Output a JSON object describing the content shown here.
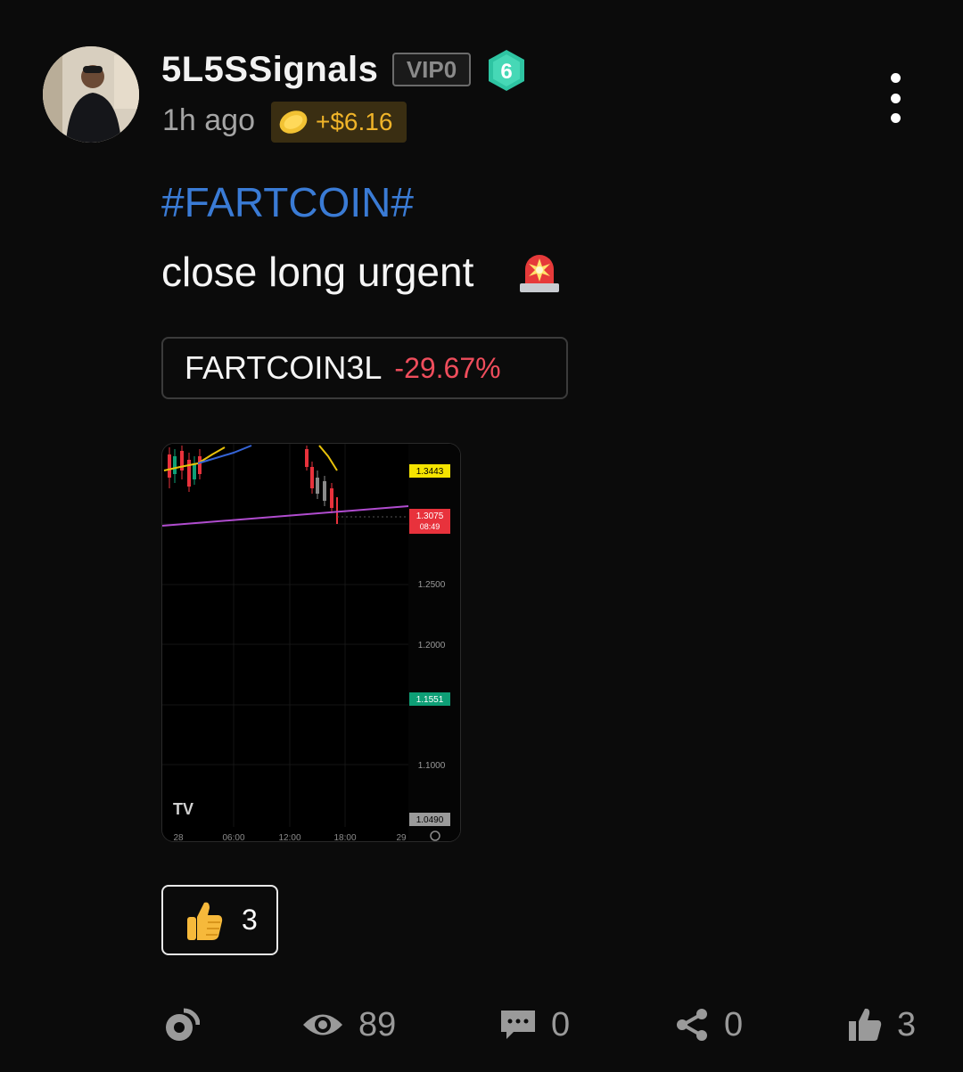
{
  "post": {
    "username": "5L5SSignals",
    "vip_label": "VIP0",
    "level": "6",
    "time_ago": "1h ago",
    "earnings": "+$6.16",
    "hashtag": "#FARTCOIN#",
    "text": "close long urgent",
    "ticker": {
      "symbol": "FARTCOIN3L",
      "change": "-29.67%"
    },
    "reaction": {
      "emoji": "thumbs-up",
      "count": "3"
    }
  },
  "stats": {
    "views": "89",
    "comments": "0",
    "shares": "0",
    "likes": "3"
  },
  "chart_image": {
    "price_tags": [
      {
        "label": "1.3443",
        "color": "#f5e400"
      },
      {
        "label": "1.3075",
        "sub": "08:49",
        "color": "#e8323c"
      },
      {
        "label": "1.1551",
        "color": "#0e9f76"
      },
      {
        "label": "1.0490",
        "color": "#9a9a9a"
      }
    ],
    "y_ticks": [
      "1.2500",
      "1.2000",
      "1.1000"
    ],
    "x_ticks": [
      "28",
      "06:00",
      "12:00",
      "18:00",
      "29"
    ],
    "logo": "TV"
  },
  "colors": {
    "hashtag": "#3a7bd5",
    "negative": "#ef4d5c",
    "gold": "#f0b429",
    "level_badge": "#2ec4a2"
  },
  "icons": [
    "avatar",
    "level-badge-icon",
    "coin-icon",
    "more-icon",
    "siren-icon",
    "thumbs-up-icon",
    "repost-icon",
    "eye-icon",
    "comment-icon",
    "share-icon",
    "like-icon"
  ]
}
